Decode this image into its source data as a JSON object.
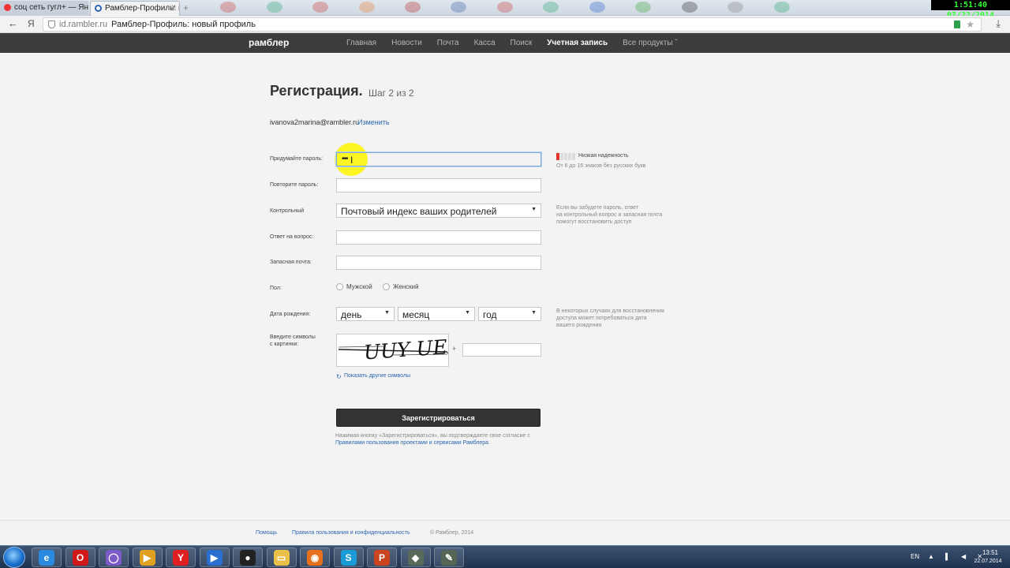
{
  "browser": {
    "tabs": [
      {
        "title": "соц сеть гугл+ — Янд"
      },
      {
        "title": "Рамблер-Профиль: н"
      }
    ],
    "new_tab_glyph": "+",
    "address": {
      "domain": "id.rambler.ru",
      "title": "Рамблер-Профиль: новый профиль",
      "ya": "Я"
    },
    "overlay_clock": "1:51:40  07/22/2014"
  },
  "site": {
    "logo": "рамблер",
    "nav": [
      "Главная",
      "Новости",
      "Почта",
      "Касса",
      "Поиск",
      "Учетная запись",
      "Все продукты ˇ"
    ]
  },
  "form": {
    "title": "Регистрация.",
    "step": "Шаг 2 из 2",
    "email": "ivanova2marina@rambler.ru",
    "change_link": "Изменить",
    "password_label": "Придумайте пароль:",
    "password_value": "•••",
    "strength_label": "Низкая надежность",
    "strength_level": 0.2,
    "password_hint": "От 6 до 16 знаков без русских букв",
    "repeat_label": "Повторите пароль:",
    "question_label": "Контрольный",
    "question_value": "Почтовый индекс ваших родителей",
    "question_hint": [
      "Если вы забудете пароль, ответ",
      "на контрольный вопрос и запасная почта",
      "помогут восстановить доступ"
    ],
    "answer_label": "Ответ на вопрос:",
    "backup_label": "Запасная почта:",
    "gender_label": "Пол:",
    "gender_options": [
      "Мужской",
      "Женский"
    ],
    "birthdate_label": "Дата рождения:",
    "day": "день",
    "month": "месяц",
    "year": "год",
    "birth_hint": [
      "В некоторых случаях для восстановления",
      "доступа может потребоваться дата",
      "вашего рождения"
    ],
    "captcha_label": [
      "Введите символы",
      "с картинки:"
    ],
    "captcha_text": "UUY UEF",
    "captcha_plus": "+",
    "refresh_link": "Показать другие символы",
    "submit": "Зарегистрироваться",
    "agree_text": "Нажимая кнопку «Зарегистрироваться», вы подтверждаете свое согласие с",
    "agree_link": "Правилами пользования проектами и сервисами Рамблера",
    "agree_end": "."
  },
  "footer": {
    "help": "Помощь",
    "rules": "Правила пользования и конфиденциальность",
    "copyright": "© Рамблер, 2014"
  },
  "taskbar": {
    "apps": [
      {
        "name": "ie-icon",
        "glyph": "e",
        "color": "#2a8ae0"
      },
      {
        "name": "opera-icon",
        "glyph": "O",
        "color": "#d01818"
      },
      {
        "name": "app-ring-icon",
        "glyph": "◯",
        "color": "#7a5bc7"
      },
      {
        "name": "media-player-icon",
        "glyph": "▶",
        "color": "#e0a020"
      },
      {
        "name": "yandex-browser-icon",
        "glyph": "Y",
        "color": "#e02020"
      },
      {
        "name": "video-player-icon",
        "glyph": "▶",
        "color": "#2a6fd0"
      },
      {
        "name": "panda-icon",
        "glyph": "●",
        "color": "#222222"
      },
      {
        "name": "explorer-folder-icon",
        "glyph": "▭",
        "color": "#e8c04a"
      },
      {
        "name": "firefox-icon",
        "glyph": "◉",
        "color": "#e6711a"
      },
      {
        "name": "skype-icon",
        "glyph": "S",
        "color": "#1a9ad6"
      },
      {
        "name": "powerpoint-icon",
        "glyph": "P",
        "color": "#c9441f"
      },
      {
        "name": "tool-app-icon",
        "glyph": "◆",
        "color": "#5a6a5a"
      },
      {
        "name": "pen-app-icon",
        "glyph": "✎",
        "color": "#556655"
      }
    ],
    "lang": "EN",
    "tray_icons": "▲ ▌ ◀ ✕",
    "time": "13:51",
    "date": "22.07.2014"
  }
}
